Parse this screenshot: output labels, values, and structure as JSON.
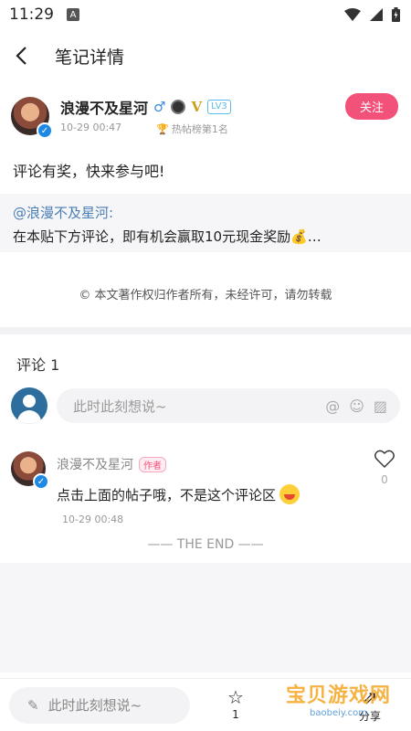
{
  "status": {
    "time": "11:29",
    "a_icon": "A"
  },
  "nav": {
    "title": "笔记详情"
  },
  "author": {
    "name": "浪漫不及星河",
    "date": "10-29 00:47",
    "hot_rank": "热帖榜第1名",
    "level": "LV3",
    "v_label": "V",
    "follow_label": "关注"
  },
  "post": {
    "text": "评论有奖，快来参与吧!",
    "quote_mention": "@浪漫不及星河:",
    "quote_body": "在本贴下方评论，即有机会赢取10元现金奖励💰…"
  },
  "copyright": "© 本文著作权归作者所有，未经许可，请勿转载",
  "comments": {
    "header": "评论 1",
    "placeholder": "此时此刻想说~",
    "items": [
      {
        "name": "浪漫不及星河",
        "tag": "作者",
        "text": "点击上面的帖子哦，不是这个评论区",
        "time": "10-29 00:48",
        "likes": "0"
      }
    ]
  },
  "end_text": "—— THE END ——",
  "bottom": {
    "placeholder": "此时此刻想说~",
    "fav_count": "1",
    "share_label": "分享"
  },
  "watermark": {
    "title": "宝贝游戏网",
    "url": "baobeiy.com"
  },
  "colors": {
    "accent": "#f2527a",
    "link": "#4a7fb6",
    "verified": "#1e88e5"
  },
  "icons": [
    "back-arrow-icon",
    "wifi-icon",
    "signal-icon",
    "battery-icon",
    "male-icon",
    "medal-icon",
    "trophy-icon",
    "at-icon",
    "emoji-icon",
    "image-icon",
    "heart-icon",
    "star-icon",
    "share-icon",
    "pencil-icon"
  ]
}
